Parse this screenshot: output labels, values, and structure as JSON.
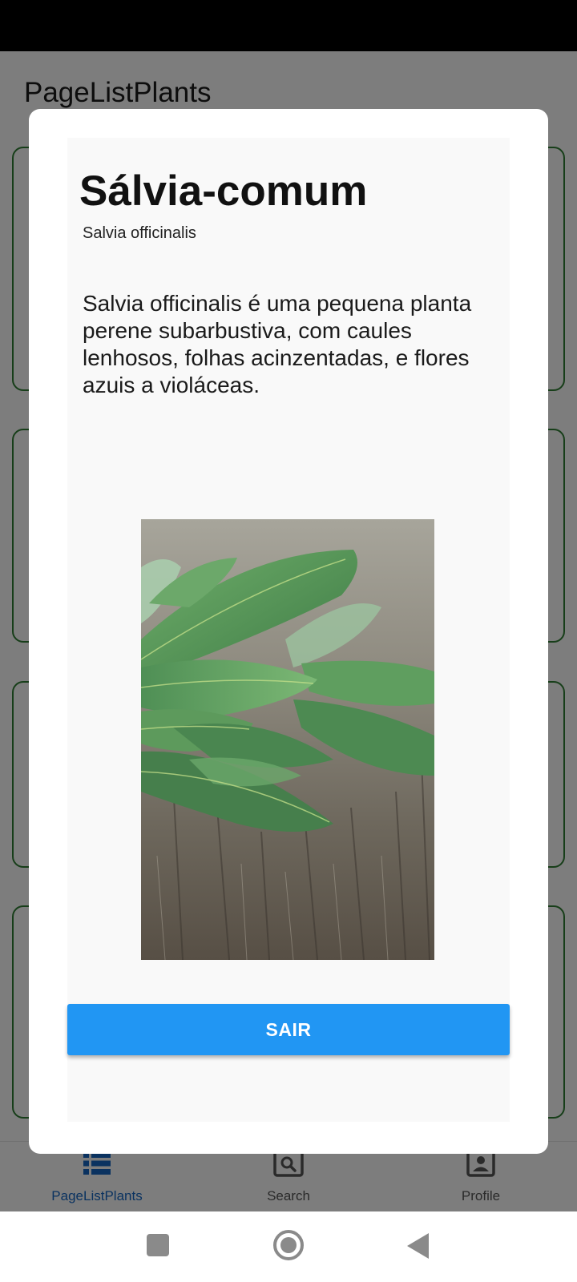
{
  "app": {
    "title": "PageListPlants"
  },
  "bottom_nav": {
    "items": [
      {
        "label": "PageListPlants",
        "icon": "list-icon",
        "active": true
      },
      {
        "label": "Search",
        "icon": "search-icon",
        "active": false
      },
      {
        "label": "Profile",
        "icon": "profile-icon",
        "active": false
      }
    ]
  },
  "dialog": {
    "common_name": "Sálvia-comum",
    "scientific_name": "Salvia officinalis",
    "description": "Salvia officinalis é uma pequena planta perene subarbustiva, com caules lenhosos, folhas acinzentadas, e flores azuis a violáceas.",
    "image": "sage-leaves-photo",
    "exit_label": "SAIR"
  },
  "system_nav": {
    "icons": [
      "recent-apps-icon",
      "home-icon",
      "back-icon"
    ]
  },
  "colors": {
    "accent": "#2196f3",
    "card_border": "#2e7d32",
    "active_nav": "#1565c0"
  }
}
